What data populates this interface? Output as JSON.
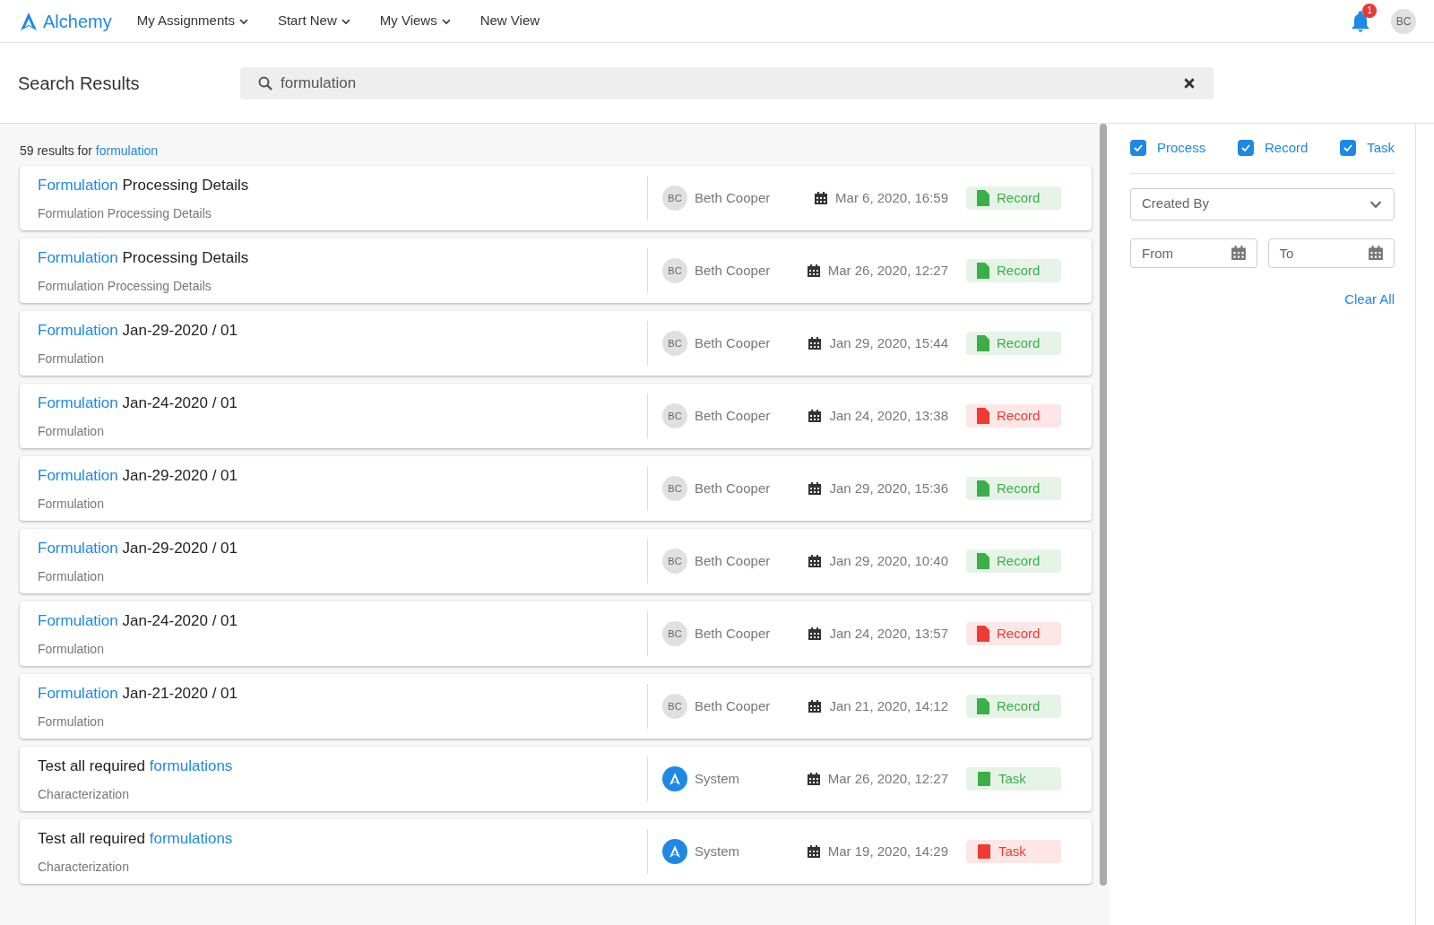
{
  "header": {
    "logo": "Alchemy",
    "nav": [
      {
        "label": "My Assignments",
        "dropdown": true
      },
      {
        "label": "Start New",
        "dropdown": true
      },
      {
        "label": "My Views",
        "dropdown": true
      },
      {
        "label": "New View",
        "dropdown": false
      }
    ],
    "notification_count": "1",
    "user_initials": "BC"
  },
  "page_title": "Search Results",
  "search": {
    "value": "formulation"
  },
  "results_summary": {
    "count_text": "59 results for",
    "query": "formulation"
  },
  "results": [
    {
      "title": [
        {
          "text": "Formulation",
          "match": true
        },
        {
          "text": " Processing Details",
          "match": false
        }
      ],
      "subtitle": "Formulation Processing Details",
      "author": {
        "kind": "user",
        "initials": "BC",
        "name": "Beth Cooper"
      },
      "date": "Mar 6, 2020, 16:59",
      "type": {
        "kind": "record",
        "flagged": false,
        "label": "Record"
      }
    },
    {
      "title": [
        {
          "text": "Formulation",
          "match": true
        },
        {
          "text": " Processing Details",
          "match": false
        }
      ],
      "subtitle": "Formulation Processing Details",
      "author": {
        "kind": "user",
        "initials": "BC",
        "name": "Beth Cooper"
      },
      "date": "Mar 26, 2020, 12:27",
      "type": {
        "kind": "record",
        "flagged": false,
        "label": "Record"
      }
    },
    {
      "title": [
        {
          "text": "Formulation",
          "match": true
        },
        {
          "text": " Jan-29-2020 / 01",
          "match": false
        }
      ],
      "subtitle": "Formulation",
      "author": {
        "kind": "user",
        "initials": "BC",
        "name": "Beth Cooper"
      },
      "date": "Jan 29, 2020, 15:44",
      "type": {
        "kind": "record",
        "flagged": false,
        "label": "Record"
      }
    },
    {
      "title": [
        {
          "text": "Formulation",
          "match": true
        },
        {
          "text": " Jan-24-2020 / 01",
          "match": false
        }
      ],
      "subtitle": "Formulation",
      "author": {
        "kind": "user",
        "initials": "BC",
        "name": "Beth Cooper"
      },
      "date": "Jan 24, 2020, 13:38",
      "type": {
        "kind": "record",
        "flagged": true,
        "label": "Record"
      }
    },
    {
      "title": [
        {
          "text": "Formulation",
          "match": true
        },
        {
          "text": " Jan-29-2020 / 01",
          "match": false
        }
      ],
      "subtitle": "Formulation",
      "author": {
        "kind": "user",
        "initials": "BC",
        "name": "Beth Cooper"
      },
      "date": "Jan 29, 2020, 15:36",
      "type": {
        "kind": "record",
        "flagged": false,
        "label": "Record"
      }
    },
    {
      "title": [
        {
          "text": "Formulation",
          "match": true
        },
        {
          "text": " Jan-29-2020 / 01",
          "match": false
        }
      ],
      "subtitle": "Formulation",
      "author": {
        "kind": "user",
        "initials": "BC",
        "name": "Beth Cooper"
      },
      "date": "Jan 29, 2020, 10:40",
      "type": {
        "kind": "record",
        "flagged": false,
        "label": "Record"
      }
    },
    {
      "title": [
        {
          "text": "Formulation",
          "match": true
        },
        {
          "text": " Jan-24-2020 / 01",
          "match": false
        }
      ],
      "subtitle": "Formulation",
      "author": {
        "kind": "user",
        "initials": "BC",
        "name": "Beth Cooper"
      },
      "date": "Jan 24, 2020, 13:57",
      "type": {
        "kind": "record",
        "flagged": true,
        "label": "Record"
      }
    },
    {
      "title": [
        {
          "text": "Formulation",
          "match": true
        },
        {
          "text": " Jan-21-2020 / 01",
          "match": false
        }
      ],
      "subtitle": "Formulation",
      "author": {
        "kind": "user",
        "initials": "BC",
        "name": "Beth Cooper"
      },
      "date": "Jan 21, 2020, 14:12",
      "type": {
        "kind": "record",
        "flagged": false,
        "label": "Record"
      }
    },
    {
      "title": [
        {
          "text": "Test all required ",
          "match": false
        },
        {
          "text": "formulations",
          "match": true
        }
      ],
      "subtitle": "Characterization",
      "author": {
        "kind": "system",
        "name": "System"
      },
      "date": "Mar 26, 2020, 12:27",
      "type": {
        "kind": "task",
        "flagged": false,
        "label": "Task"
      }
    },
    {
      "title": [
        {
          "text": "Test all required ",
          "match": false
        },
        {
          "text": "formulations",
          "match": true
        }
      ],
      "subtitle": "Characterization",
      "author": {
        "kind": "system",
        "name": "System"
      },
      "date": "Mar 19, 2020, 14:29",
      "type": {
        "kind": "task",
        "flagged": true,
        "label": "Task"
      }
    }
  ],
  "filters": {
    "types": [
      {
        "label": "Process",
        "checked": true
      },
      {
        "label": "Record",
        "checked": true
      },
      {
        "label": "Task",
        "checked": true
      }
    ],
    "created_by": {
      "placeholder": "Created By"
    },
    "from": {
      "placeholder": "From"
    },
    "to": {
      "placeholder": "To"
    },
    "clear_all": "Clear All"
  }
}
